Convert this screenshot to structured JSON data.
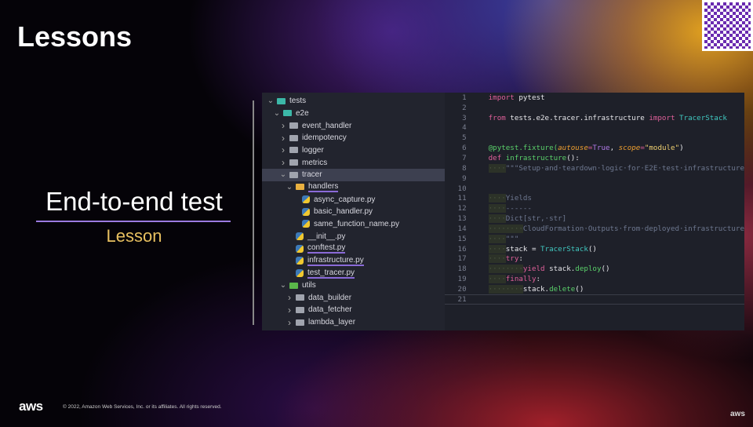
{
  "slide": {
    "title": "Lessons",
    "lesson_title": "End-to-end test",
    "lesson_sub": "Lesson"
  },
  "footer": {
    "logo": "aws",
    "copyright": "© 2022, Amazon Web Services, Inc. or its affiliates. All rights reserved.",
    "corner_logo": "aws"
  },
  "tree": [
    {
      "label": "tests",
      "depth": 0,
      "chev": "v",
      "icon": "folder teal"
    },
    {
      "label": "e2e",
      "depth": 1,
      "chev": "v",
      "icon": "folder teal"
    },
    {
      "label": "event_handler",
      "depth": 2,
      "chev": ">",
      "icon": "folder"
    },
    {
      "label": "idempotency",
      "depth": 2,
      "chev": ">",
      "icon": "folder"
    },
    {
      "label": "logger",
      "depth": 2,
      "chev": ">",
      "icon": "folder"
    },
    {
      "label": "metrics",
      "depth": 2,
      "chev": ">",
      "icon": "folder"
    },
    {
      "label": "tracer",
      "depth": 2,
      "chev": "v",
      "icon": "folder",
      "selected": true
    },
    {
      "label": "handlers",
      "depth": 3,
      "chev": "v",
      "icon": "folder yellow",
      "underline": true
    },
    {
      "label": "async_capture.py",
      "depth": 4,
      "chev": "",
      "icon": "py"
    },
    {
      "label": "basic_handler.py",
      "depth": 4,
      "chev": "",
      "icon": "py"
    },
    {
      "label": "same_function_name.py",
      "depth": 4,
      "chev": "",
      "icon": "py"
    },
    {
      "label": "__init__.py",
      "depth": 3,
      "chev": "",
      "icon": "py"
    },
    {
      "label": "conftest.py",
      "depth": 3,
      "chev": "",
      "icon": "py",
      "underline": true
    },
    {
      "label": "infrastructure.py",
      "depth": 3,
      "chev": "",
      "icon": "py",
      "underline": true
    },
    {
      "label": "test_tracer.py",
      "depth": 3,
      "chev": "",
      "icon": "py",
      "underline": true
    },
    {
      "label": "utils",
      "depth": 2,
      "chev": "v",
      "icon": "folder green"
    },
    {
      "label": "data_builder",
      "depth": 3,
      "chev": ">",
      "icon": "folder"
    },
    {
      "label": "data_fetcher",
      "depth": 3,
      "chev": ">",
      "icon": "folder"
    },
    {
      "label": "lambda_layer",
      "depth": 3,
      "chev": ">",
      "icon": "folder"
    }
  ],
  "code": [
    [
      [
        "import",
        "k"
      ],
      [
        " pytest",
        "n"
      ]
    ],
    [],
    [
      [
        "from",
        "k"
      ],
      [
        " tests.e2e.tracer.infrastructure ",
        "n"
      ],
      [
        "import",
        "k"
      ],
      [
        " TracerStack",
        "cls"
      ]
    ],
    [],
    [],
    [
      [
        "@pytest.fixture(",
        "f"
      ],
      [
        "autouse",
        "p"
      ],
      [
        "=",
        "k"
      ],
      [
        "True",
        "b"
      ],
      [
        ", ",
        "n"
      ],
      [
        "scope",
        "p"
      ],
      [
        "=",
        "k"
      ],
      [
        "\"module\"",
        "s"
      ],
      [
        ")",
        "n"
      ]
    ],
    [
      [
        "def",
        "k"
      ],
      [
        " infrastructure",
        "f"
      ],
      [
        "():",
        "n"
      ]
    ],
    [
      [
        "····",
        "ind"
      ],
      [
        "\"\"\"Setup·and·teardown·logic·for·E2E·test·infrastructure",
        "c"
      ]
    ],
    [],
    [],
    [
      [
        "····",
        "ind"
      ],
      [
        "Yields",
        "c"
      ]
    ],
    [
      [
        "····",
        "ind"
      ],
      [
        "------",
        "c"
      ]
    ],
    [
      [
        "····",
        "ind"
      ],
      [
        "Dict[str,·str]",
        "c"
      ]
    ],
    [
      [
        "········",
        "ind"
      ],
      [
        "CloudFormation·Outputs·from·deployed·infrastructure",
        "c"
      ]
    ],
    [
      [
        "····",
        "ind"
      ],
      [
        "\"\"\"",
        "c"
      ]
    ],
    [
      [
        "····",
        "ind"
      ],
      [
        "stack = ",
        "n"
      ],
      [
        "TracerStack",
        "cls"
      ],
      [
        "()",
        "n"
      ]
    ],
    [
      [
        "····",
        "ind"
      ],
      [
        "try",
        "k"
      ],
      [
        ":",
        "n"
      ]
    ],
    [
      [
        "········",
        "ind"
      ],
      [
        "yield",
        "k"
      ],
      [
        " stack.",
        "n"
      ],
      [
        "deploy",
        "f"
      ],
      [
        "()",
        "n"
      ]
    ],
    [
      [
        "····",
        "ind"
      ],
      [
        "finally",
        "k"
      ],
      [
        ":",
        "n"
      ]
    ],
    [
      [
        "········",
        "ind"
      ],
      [
        "stack.",
        "n"
      ],
      [
        "delete",
        "f"
      ],
      [
        "()",
        "n"
      ]
    ],
    []
  ]
}
